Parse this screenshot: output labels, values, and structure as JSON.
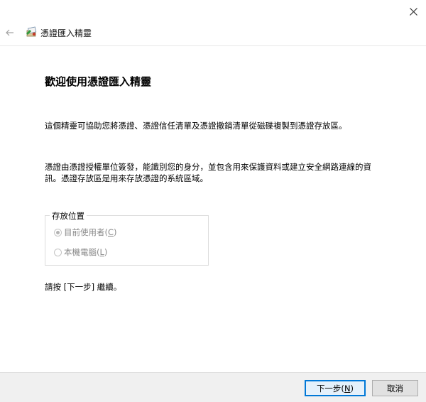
{
  "window": {
    "title": "憑證匯入精靈",
    "close_icon": "close-icon",
    "back_icon": "back-arrow-icon",
    "app_icon": "certificate-wizard-icon"
  },
  "main": {
    "heading": "歡迎使用憑證匯入精靈",
    "paragraph1": "這個精靈可協助您將憑證、憑證信任清單及憑證撤銷清單從磁碟複製到憑證存放區。",
    "paragraph2": "憑證由憑證授權單位簽發，能識別您的身分，並包含用來保護資料或建立安全網路連線的資訊。憑證存放區是用來存放憑證的系統區域。",
    "store_location": {
      "legend": "存放位置",
      "options": [
        {
          "label_main": "目前使用者(",
          "accel": "C",
          "label_end": ")",
          "selected": true,
          "enabled": false
        },
        {
          "label_main": "本機電腦(",
          "accel": "L",
          "label_end": ")",
          "selected": false,
          "enabled": false
        }
      ]
    },
    "continue_text": "請按 [下一步] 繼續。"
  },
  "footer": {
    "next": {
      "main": "下一步(",
      "accel": "N",
      "end": ")"
    },
    "cancel": "取消"
  },
  "colors": {
    "accent_border": "#0078d7",
    "footer_bg": "#f0f0f0",
    "disabled_text": "#8a8a8a"
  }
}
